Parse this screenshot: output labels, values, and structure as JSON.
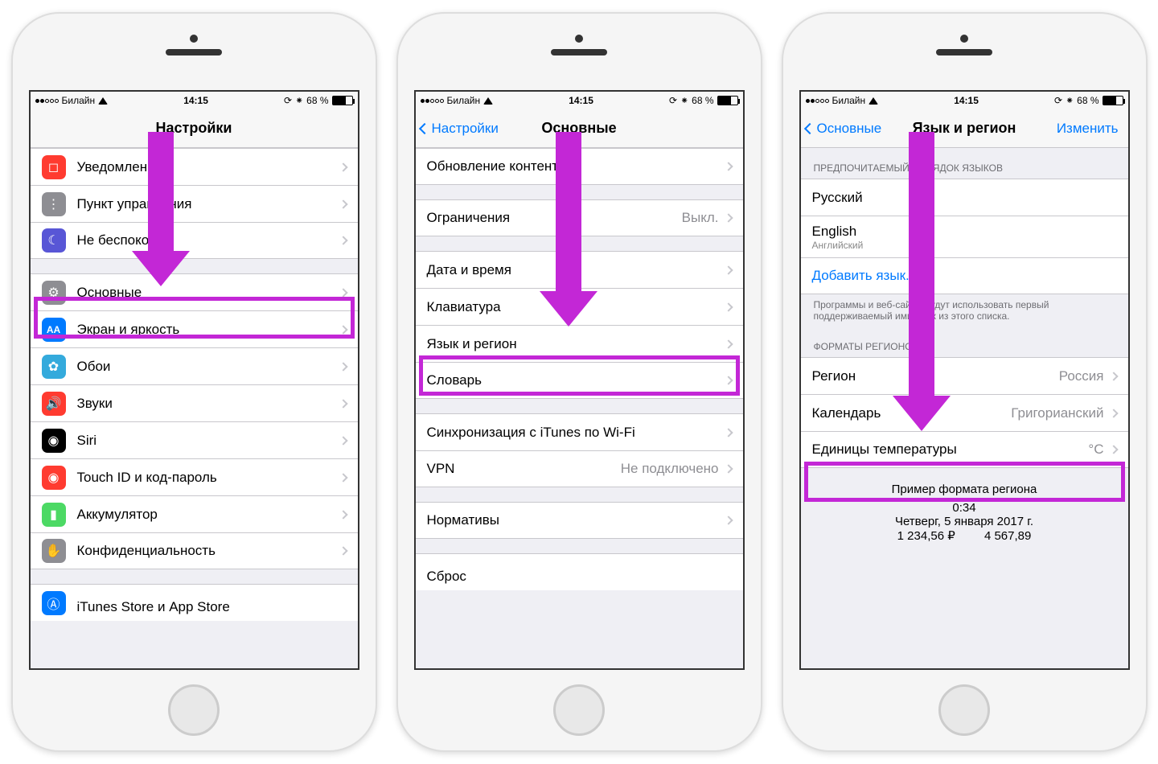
{
  "statusBar": {
    "carrier": "Билайн",
    "time": "14:15",
    "battery": "68 %"
  },
  "phone1": {
    "title": "Настройки",
    "rows": {
      "notifications": "Уведомления",
      "controlCenter": "Пункт управления",
      "dnd": "Не беспокоить",
      "general": "Основные",
      "display": "Экран и яркость",
      "wallpaper": "Обои",
      "sounds": "Звуки",
      "siri": "Siri",
      "touchid": "Touch ID и код-пароль",
      "battery": "Аккумулятор",
      "privacy": "Конфиденциальность",
      "itunes": "iTunes Store и App Store"
    }
  },
  "phone2": {
    "back": "Настройки",
    "title": "Основные",
    "rows": {
      "contentRefresh": "Обновление контента",
      "restrictions": "Ограничения",
      "restrictionsValue": "Выкл.",
      "datetime": "Дата и время",
      "keyboard": "Клавиатура",
      "langRegion": "Язык и регион",
      "dictionary": "Словарь",
      "itunesWifi": "Синхронизация с iTunes по Wi-Fi",
      "vpn": "VPN",
      "vpnValue": "Не подключено",
      "regulatory": "Нормативы",
      "reset": "Сброс"
    }
  },
  "phone3": {
    "back": "Основные",
    "title": "Язык и регион",
    "edit": "Изменить",
    "header1": "ПРЕДПОЧИТАЕМЫЙ ПОРЯДОК ЯЗЫКОВ",
    "lang1": "Русский",
    "lang2": "English",
    "lang2sub": "Английский",
    "addLang": "Добавить язык...",
    "footer1": "Программы и веб-сайты будут использовать первый поддерживаемый ими язык из этого списка.",
    "header2": "ФОРМАТЫ РЕГИОНОВ",
    "region": "Регион",
    "regionValue": "Россия",
    "calendar": "Календарь",
    "calendarValue": "Григорианский",
    "tempUnits": "Единицы температуры",
    "tempValue": "°C",
    "exampleTitle": "Пример формата региона",
    "exampleTime": "0:34",
    "exampleDate": "Четверг, 5 января 2017 г.",
    "exampleNum1": "1 234,56 ₽",
    "exampleNum2": "4 567,89"
  }
}
